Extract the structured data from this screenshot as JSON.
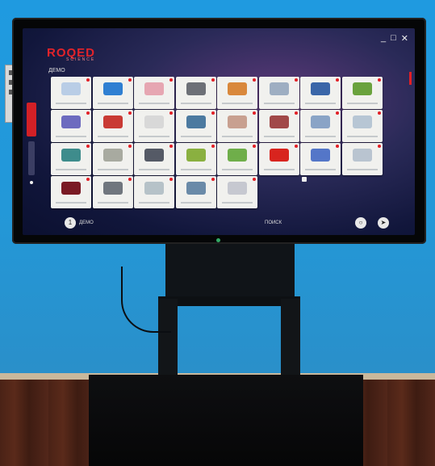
{
  "app": {
    "logo": "ROQED",
    "logo_sub": "SCIENCE",
    "section": "ДЕМО",
    "bottom_left_label": "ДЕМО",
    "bottom_center_label": "ПОИСК",
    "page_indicator": "1"
  },
  "window": {
    "minimize": "_",
    "maximize": "□",
    "close": "✕"
  },
  "colors": {
    "brand_red": "#e2232a",
    "screen_bg": "#1a1d45",
    "wall": "#1f9ae0"
  },
  "icons": [
    "search-icon",
    "send-icon",
    "minimize-icon",
    "maximize-icon",
    "close-icon"
  ],
  "tiles": [
    {
      "color": "#b9cde6"
    },
    {
      "color": "#2f7fd2"
    },
    {
      "color": "#e6a6b2"
    },
    {
      "color": "#6d7077"
    },
    {
      "color": "#d9883c"
    },
    {
      "color": "#9eaec2"
    },
    {
      "color": "#3a66a8"
    },
    {
      "color": "#6aa23d"
    },
    {
      "color": "#6d6bbf"
    },
    {
      "color": "#c93a34"
    },
    {
      "color": "#d8d8d8"
    },
    {
      "color": "#4c7aa0"
    },
    {
      "color": "#c8a090"
    },
    {
      "color": "#a14848"
    },
    {
      "color": "#8aa4c6"
    },
    {
      "color": "#b7c6d4"
    },
    {
      "color": "#3e8c8c"
    },
    {
      "color": "#a8aaa0"
    },
    {
      "color": "#555a66"
    },
    {
      "color": "#8ab040"
    },
    {
      "color": "#6fae4a"
    },
    {
      "color": "#d8241e"
    },
    {
      "color": "#5476c8"
    },
    {
      "color": "#b9c4d0"
    },
    {
      "color": "#7a1a24"
    },
    {
      "color": "#70767e"
    },
    {
      "color": "#b6c2c8"
    },
    {
      "color": "#6a8aa8"
    },
    {
      "color": "#c6c8d0"
    }
  ]
}
